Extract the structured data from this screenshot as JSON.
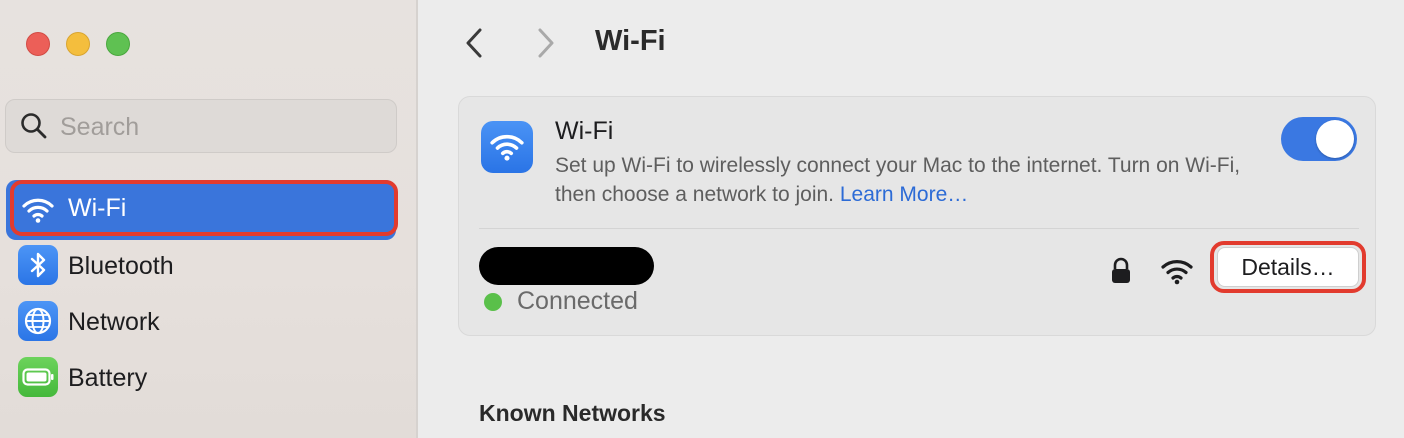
{
  "sidebar": {
    "search": {
      "placeholder": "Search",
      "value": ""
    },
    "items": [
      {
        "label": "Wi-Fi",
        "icon": "wifi-icon",
        "selected": true
      },
      {
        "label": "Bluetooth",
        "icon": "bluetooth-icon",
        "selected": false
      },
      {
        "label": "Network",
        "icon": "globe-icon",
        "selected": false
      },
      {
        "label": "Battery",
        "icon": "battery-icon",
        "selected": false
      }
    ]
  },
  "header": {
    "title": "Wi-Fi",
    "back_icon": "chevron-left-icon",
    "forward_icon": "chevron-right-icon"
  },
  "wifi_card": {
    "title": "Wi-Fi",
    "description": "Set up Wi-Fi to wirelessly connect your Mac to the internet. Turn on Wi-Fi, then choose a network to join.",
    "learn_more": "Learn More…",
    "toggle_on": true
  },
  "current_network": {
    "status": "Connected",
    "details_label": "Details…"
  },
  "known_networks": {
    "title": "Known Networks"
  },
  "colors": {
    "accent": "#3a75db",
    "highlight_annotation": "#e23b2e",
    "status_connected": "#5ac04a"
  }
}
